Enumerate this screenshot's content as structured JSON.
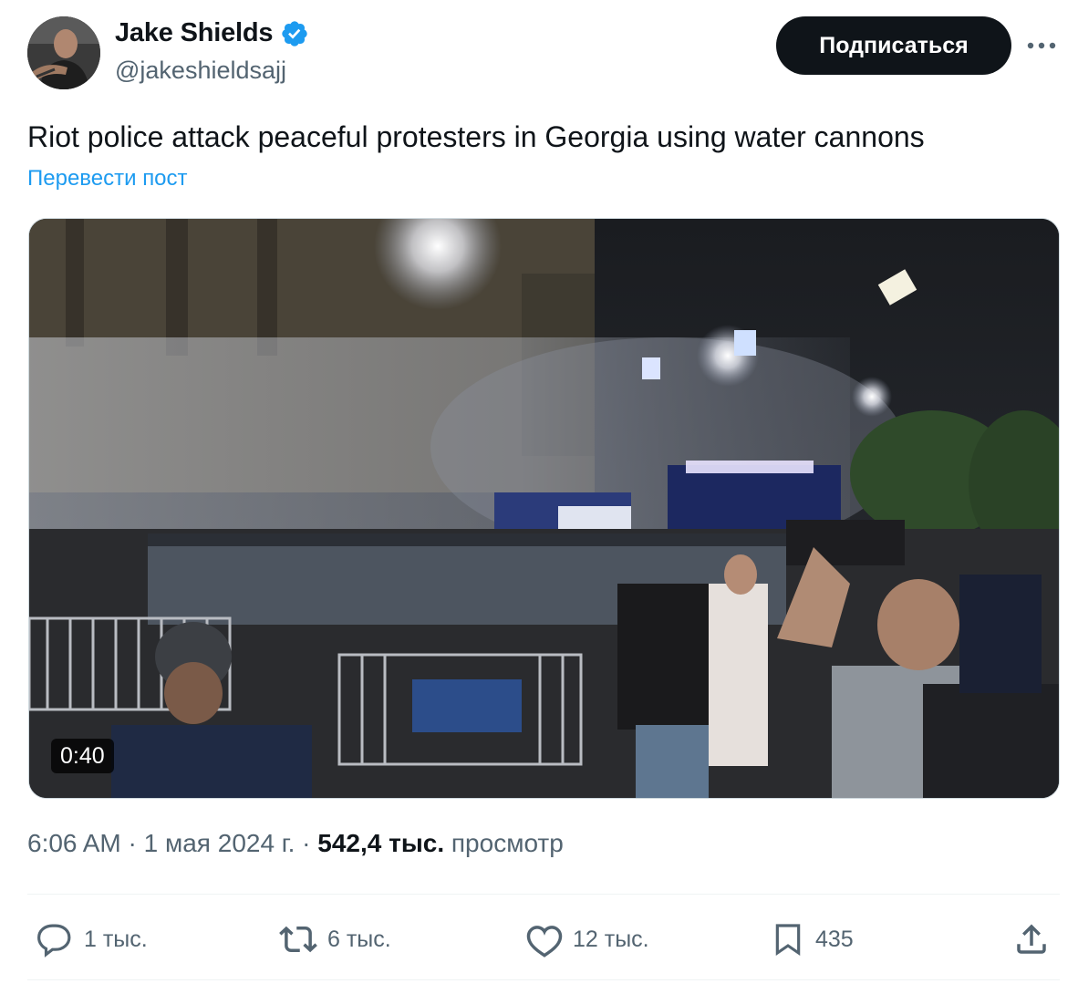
{
  "author": {
    "name": "Jake Shields",
    "handle": "@jakeshieldsajj",
    "verified_icon": "verified-badge-icon",
    "verified_color": "#1d9bf0"
  },
  "header": {
    "follow_label": "Подписаться",
    "more_icon": "more-icon"
  },
  "post": {
    "text": "Riot police attack peaceful protesters in Georgia using water cannons",
    "translate_label": "Перевести пост"
  },
  "media": {
    "type": "video",
    "duration": "0:40"
  },
  "meta": {
    "time": "6:06 AM",
    "separator": "·",
    "date": "1 мая 2024 г.",
    "views_count": "542,4 тыс.",
    "views_label": "просмотр"
  },
  "actions": {
    "reply": {
      "icon": "reply-icon",
      "count": "1 тыс."
    },
    "repost": {
      "icon": "repost-icon",
      "count": "6 тыс."
    },
    "like": {
      "icon": "like-icon",
      "count": "12 тыс."
    },
    "bookmark": {
      "icon": "bookmark-icon",
      "count": "435"
    },
    "share": {
      "icon": "share-icon"
    }
  },
  "colors": {
    "text_primary": "#0f1419",
    "text_secondary": "#536471",
    "link": "#1d9bf0",
    "button_bg": "#0f1419"
  }
}
